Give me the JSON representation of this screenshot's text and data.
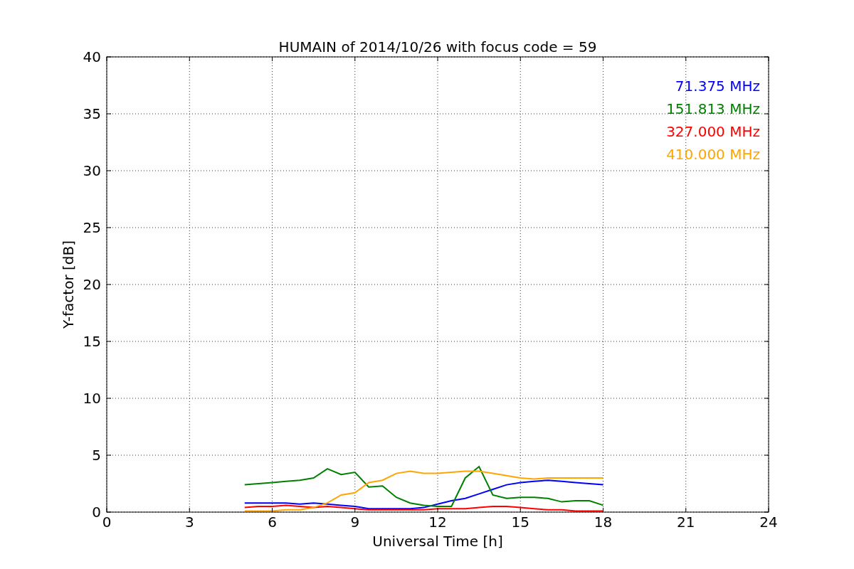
{
  "chart_data": {
    "type": "line",
    "title": "HUMAIN of 2014/10/26 with focus code = 59",
    "xlabel": "Universal Time [h]",
    "ylabel": "Y-factor [dB]",
    "x": [
      5,
      5.5,
      6,
      6.5,
      7,
      7.5,
      8,
      8.5,
      9,
      9.5,
      10,
      10.5,
      11,
      11.5,
      12,
      12.5,
      13,
      13.5,
      14,
      14.5,
      15,
      15.5,
      16,
      16.5,
      17,
      17.5,
      18
    ],
    "series": [
      {
        "name": "71.375 MHz",
        "color": "#0000ff",
        "values": [
          0.8,
          0.8,
          0.8,
          0.8,
          0.7,
          0.8,
          0.7,
          0.6,
          0.5,
          0.3,
          0.3,
          0.3,
          0.3,
          0.4,
          0.7,
          1.0,
          1.2,
          1.6,
          2.0,
          2.4,
          2.6,
          2.7,
          2.8,
          2.7,
          2.6,
          2.5,
          2.4
        ]
      },
      {
        "name": "151.813 MHz",
        "color": "#008000",
        "values": [
          2.4,
          2.5,
          2.6,
          2.7,
          2.8,
          3.0,
          3.8,
          3.3,
          3.5,
          2.2,
          2.3,
          1.3,
          0.8,
          0.6,
          0.5,
          0.5,
          3.0,
          4.0,
          1.5,
          1.2,
          1.3,
          1.3,
          1.2,
          0.9,
          1.0,
          1.0,
          0.6
        ]
      },
      {
        "name": "327.000 MHz",
        "color": "#ff0000",
        "values": [
          0.4,
          0.5,
          0.5,
          0.6,
          0.5,
          0.4,
          0.5,
          0.4,
          0.3,
          0.2,
          0.2,
          0.2,
          0.2,
          0.2,
          0.3,
          0.3,
          0.3,
          0.4,
          0.5,
          0.5,
          0.4,
          0.3,
          0.2,
          0.2,
          0.1,
          0.1,
          0.1
        ]
      },
      {
        "name": "410.000 MHz",
        "color": "#ffa500",
        "values": [
          0.1,
          0.1,
          0.1,
          0.2,
          0.2,
          0.4,
          0.8,
          1.5,
          1.7,
          2.6,
          2.8,
          3.4,
          3.6,
          3.4,
          3.4,
          3.5,
          3.6,
          3.6,
          3.4,
          3.2,
          3.0,
          2.9,
          3.0,
          3.0,
          3.0,
          3.0,
          3.0
        ]
      }
    ],
    "xlim": [
      0,
      24
    ],
    "ylim": [
      0,
      40
    ],
    "xticks": [
      0,
      3,
      6,
      9,
      12,
      15,
      18,
      21,
      24
    ],
    "yticks": [
      0,
      5,
      10,
      15,
      20,
      25,
      30,
      35,
      40
    ],
    "grid": true
  }
}
